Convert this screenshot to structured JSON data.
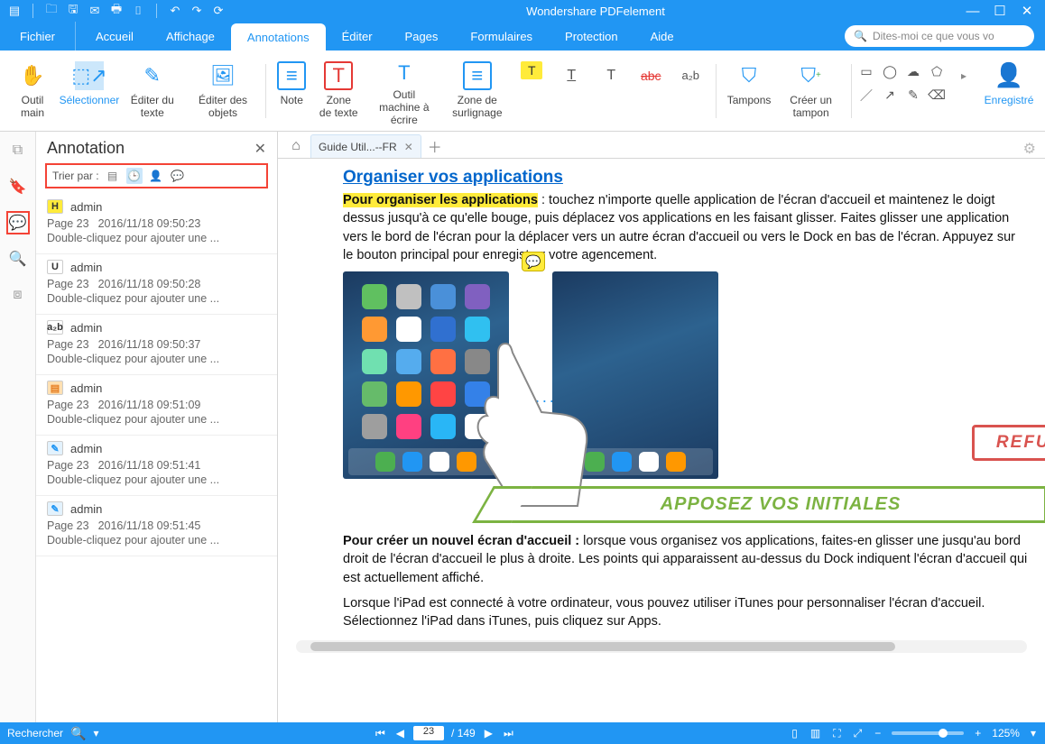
{
  "app": {
    "title": "Wondershare PDFelement"
  },
  "qat_icons": [
    "menu",
    "open",
    "save",
    "email",
    "print",
    "scan",
    "undo",
    "redo",
    "cloud"
  ],
  "menu": {
    "file": "Fichier",
    "items": [
      "Accueil",
      "Affichage",
      "Annotations",
      "Éditer",
      "Pages",
      "Formulaires",
      "Protection",
      "Aide"
    ],
    "active_index": 2,
    "search_placeholder": "Dites-moi ce que vous vo"
  },
  "ribbon": {
    "hand": "Outil main",
    "select": "Sélectionner",
    "edit_text": "Éditer du texte",
    "edit_objects": "Éditer des objets",
    "note": "Note",
    "textbox": "Zone de texte",
    "typewriter": "Outil machine à écrire",
    "highlight": "Zone de surlignage",
    "strike": "abc",
    "replace": "a₂b",
    "stamps": "Tampons",
    "create_stamp": "Créer un tampon",
    "register": "Enregistré"
  },
  "sidebar_icons": [
    "pages",
    "bookmark",
    "annotations",
    "search",
    "attachments"
  ],
  "sidebar_active": 2,
  "annot_panel": {
    "title": "Annotation",
    "sort_label": "Trier par :",
    "items": [
      {
        "type": "H",
        "type_bg": "#ffeb3b",
        "type_color": "#333",
        "author": "admin",
        "page": "Page 23",
        "time": "2016/11/18 09:50:23",
        "note": "Double-cliquez pour ajouter une ..."
      },
      {
        "type": "U",
        "type_bg": "#fff",
        "type_color": "#333",
        "author": "admin",
        "page": "Page 23",
        "time": "2016/11/18 09:50:28",
        "note": "Double-cliquez pour ajouter une ..."
      },
      {
        "type": "a₂b",
        "type_bg": "#fff",
        "type_color": "#333",
        "author": "admin",
        "page": "Page 23",
        "time": "2016/11/18 09:50:37",
        "note": "Double-cliquez pour ajouter une ..."
      },
      {
        "type": "▤",
        "type_bg": "#ffe0b2",
        "type_color": "#e67e22",
        "author": "admin",
        "page": "Page 23",
        "time": "2016/11/18 09:51:09",
        "note": "Double-cliquez pour ajouter une ..."
      },
      {
        "type": "✎",
        "type_bg": "#e3f2fd",
        "type_color": "#2196f3",
        "author": "admin",
        "page": "Page 23",
        "time": "2016/11/18 09:51:41",
        "note": "Double-cliquez pour ajouter une ..."
      },
      {
        "type": "✎",
        "type_bg": "#e3f2fd",
        "type_color": "#2196f3",
        "author": "admin",
        "page": "Page 23",
        "time": "2016/11/18 09:51:45",
        "note": "Double-cliquez pour ajouter une ..."
      }
    ]
  },
  "tabs": {
    "doc_name": "Guide Util...--FR"
  },
  "doc": {
    "heading": "Organiser vos applications",
    "hl_lead": "Pour organiser les applications",
    "para1_rest": " : touchez n'importe quelle application de l'écran d'accueil et maintenez le doigt dessus jusqu'à ce qu'elle bouge, puis déplacez vos applications en les faisant glisser. Faites glisser une application vers le bord de l'écran pour la déplacer vers un autre écran d'accueil ou vers le Dock en bas de l'écran. Appuyez sur le bouton principal pour enregistrer votre agencement.",
    "stamp_refuse": "REFUSÉ",
    "stamp_initials": "APPOSEZ VOS INITIALES",
    "para2_lead": "Pour créer un nouvel écran d'accueil :",
    "para2_rest": " lorsque vous organisez vos applications, faites-en glisser une jusqu'au bord droit de l'écran d'accueil le plus à droite. Les points qui apparaissent au-dessus du Dock indiquent l'écran d'accueil qui est actuellement affiché.",
    "para3": "Lorsque l'iPad est connecté à votre ordinateur, vous pouvez utiliser iTunes pour personnaliser l'écran d'accueil. Sélectionnez l'iPad dans iTunes, puis cliquez sur Apps."
  },
  "status": {
    "search": "Rechercher",
    "page_current": "23",
    "page_total": "/ 149",
    "zoom": "125%"
  },
  "app_colors": [
    "#60c060",
    "#c0c0c0",
    "#4a90d9",
    "#8060c0",
    "#ff9933",
    "#ffffff",
    "#3070d0",
    "#30c0f0",
    "#70e0b0",
    "#55acee",
    "#ff7043",
    "#888888",
    "#66bb6a",
    "#ff9800",
    "#ff4444",
    "#3481e8",
    "#9e9e9e",
    "#ff4081",
    "#29b6f6",
    "#ffffff"
  ],
  "dock_colors": [
    "#4caf50",
    "#2196f3",
    "#ffffff",
    "#ff9800"
  ]
}
